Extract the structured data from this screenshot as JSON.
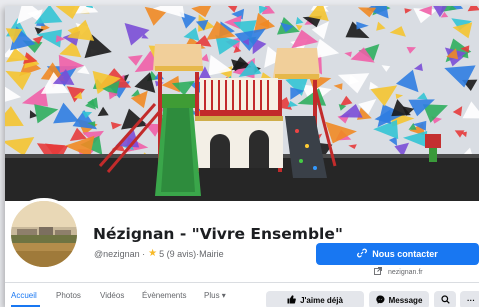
{
  "page": {
    "name": "Nézignan - \"Vivre Ensemble\"",
    "handle": "@nezignan",
    "rating_text": "5 (9 avis)",
    "separator": " · ",
    "category": "Mairie"
  },
  "actions": {
    "contact_label": "Nous contacter",
    "website": "nezignan.fr",
    "like_label": "J'aime déjà",
    "message_label": "Message",
    "more_label": "···"
  },
  "tabs": [
    {
      "label": "Accueil",
      "active": true
    },
    {
      "label": "Photos"
    },
    {
      "label": "Vidéos"
    },
    {
      "label": "Évènements"
    },
    {
      "label": "Plus ▾"
    }
  ],
  "colors": {
    "brand_blue": "#1877f2",
    "star": "#f7b928"
  },
  "icons": {
    "link": "link-icon",
    "external": "external-link-icon",
    "like": "thumbs-up-icon",
    "message": "messenger-icon",
    "search": "search-icon"
  }
}
